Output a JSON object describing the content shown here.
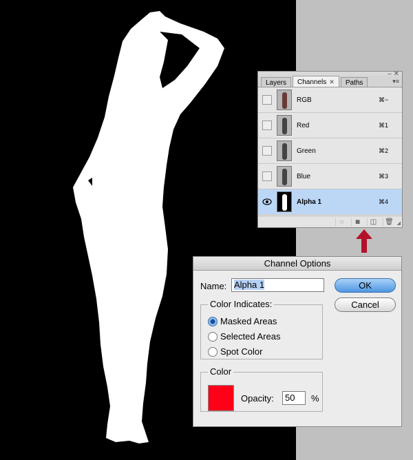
{
  "panel": {
    "tabs": [
      {
        "label": "Layers"
      },
      {
        "label": "Channels",
        "close": "✕"
      },
      {
        "label": "Paths"
      }
    ],
    "channels": [
      {
        "name": "RGB",
        "shortcut": "⌘~",
        "visible": false
      },
      {
        "name": "Red",
        "shortcut": "⌘1",
        "visible": false
      },
      {
        "name": "Green",
        "shortcut": "⌘2",
        "visible": false
      },
      {
        "name": "Blue",
        "shortcut": "⌘3",
        "visible": false
      },
      {
        "name": "Alpha 1",
        "shortcut": "⌘4",
        "visible": true,
        "selected": true
      }
    ],
    "footer_icons": [
      "load-selection-icon",
      "save-selection-icon",
      "new-channel-icon",
      "trash-icon"
    ]
  },
  "dialog": {
    "title": "Channel Options",
    "name_label": "Name:",
    "name_value": "Alpha 1",
    "ok_label": "OK",
    "cancel_label": "Cancel",
    "color_indicates": {
      "title": "Color Indicates:",
      "options": [
        "Masked Areas",
        "Selected Areas",
        "Spot Color"
      ],
      "selected": "Masked Areas"
    },
    "color": {
      "title": "Color",
      "swatch": "#ff0019",
      "opacity_label": "Opacity:",
      "opacity_value": "50",
      "opacity_unit": "%"
    }
  },
  "colors": {
    "accent_arrow": "#b3122a",
    "selection": "#bcd6f6"
  }
}
